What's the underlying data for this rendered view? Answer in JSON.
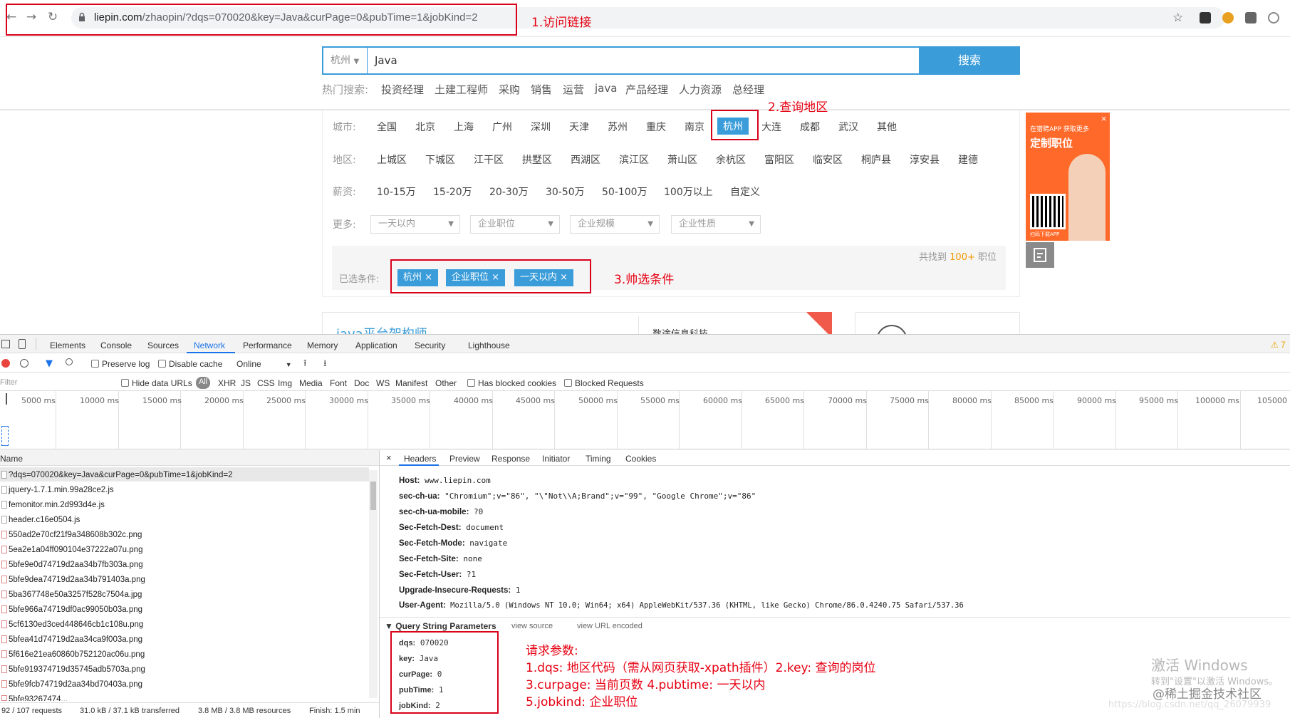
{
  "browser": {
    "url_host": "liepin.com",
    "url_path": "/zhaopin/?dqs=070020&key=Java&curPage=0&pubTime=1&jobKind=2"
  },
  "annotations": {
    "a1": "1.访问链接",
    "a2": "2.查询地区",
    "a3": "3.帅选条件"
  },
  "search": {
    "city": "杭州",
    "keyword": "Java",
    "button": "搜索",
    "hot_label": "热门搜索:",
    "hot_items": [
      "投资经理",
      "土建工程师",
      "采购",
      "销售",
      "运营",
      "java",
      "产品经理",
      "人力资源",
      "总经理"
    ]
  },
  "filters": {
    "city_label": "城市:",
    "cities": [
      "全国",
      "北京",
      "上海",
      "广州",
      "深圳",
      "天津",
      "苏州",
      "重庆",
      "南京",
      "杭州",
      "大连",
      "成都",
      "武汉",
      "其他"
    ],
    "district_label": "地区:",
    "districts": [
      "上城区",
      "下城区",
      "江干区",
      "拱墅区",
      "西湖区",
      "滨江区",
      "萧山区",
      "余杭区",
      "富阳区",
      "临安区",
      "桐庐县",
      "淳安县",
      "建德"
    ],
    "salary_label": "薪资:",
    "salaries": [
      "10-15万",
      "15-20万",
      "20-30万",
      "30-50万",
      "50-100万",
      "100万以上",
      "自定义"
    ],
    "more_label": "更多:",
    "dropdowns": [
      "一天以内",
      "企业职位",
      "企业规模",
      "企业性质"
    ],
    "found_prefix": "共找到",
    "found_count": "100+",
    "found_suffix": "职位",
    "selected_label": "已选条件:",
    "selected": [
      "杭州 ×",
      "企业职位 ×",
      "一天以内 ×"
    ]
  },
  "job_card": {
    "title": "java平台架构师",
    "company": "数途信息科技"
  },
  "ad": {
    "line1": "在猎聘APP 获取更多",
    "line2": "定制职位",
    "line3": "扫码下载APP"
  },
  "devtools": {
    "tabs": [
      "Elements",
      "Console",
      "Sources",
      "Network",
      "Performance",
      "Memory",
      "Application",
      "Security",
      "Lighthouse"
    ],
    "warning_count": "7",
    "preserve_log": "Preserve log",
    "disable_cache": "Disable cache",
    "throttle": "Online",
    "filter_placeholder": "Filter",
    "hide_data_urls": "Hide data URLs",
    "type_filters": [
      "All",
      "XHR",
      "JS",
      "CSS",
      "Img",
      "Media",
      "Font",
      "Doc",
      "WS",
      "Manifest",
      "Other"
    ],
    "has_blocked": "Has blocked cookies",
    "blocked_requests": "Blocked Requests",
    "ticks": [
      "5000 ms",
      "10000 ms",
      "15000 ms",
      "20000 ms",
      "25000 ms",
      "30000 ms",
      "35000 ms",
      "40000 ms",
      "45000 ms",
      "50000 ms",
      "55000 ms",
      "60000 ms",
      "65000 ms",
      "70000 ms",
      "75000 ms",
      "80000 ms",
      "85000 ms",
      "90000 ms",
      "95000 ms",
      "100000 ms",
      "105000"
    ],
    "name_header": "Name",
    "requests": [
      "?dqs=070020&key=Java&curPage=0&pubTime=1&jobKind=2",
      "jquery-1.7.1.min.99a28ce2.js",
      "femonitor.min.2d993d4e.js",
      "header.c16e0504.js",
      "550ad2e70cf21f9a348608b302c.png",
      "5ea2e1a04ff090104e37222a07u.png",
      "5bfe9e0d74719d2aa34b7fb303a.png",
      "5bfe9dea74719d2aa34b791403a.png",
      "5ba367748e50a3257f528c7504a.jpg",
      "5bfe966a74719df0ac99050b03a.png",
      "5cf6130ed3ced448646cb1c108u.png",
      "5bfea41d74719d2aa34ca9f003a.png",
      "5f616e21ea60860b752120ac06u.png",
      "5bfe919374719d35745adb5703a.png",
      "5bfe9fcb74719d2aa34bd70403a.png",
      "5bfe93267474..."
    ],
    "status": {
      "requests": "92 / 107 requests",
      "transferred": "31.0 kB / 37.1 kB transferred",
      "resources": "3.8 MB / 3.8 MB resources",
      "finish": "Finish: 1.5 min"
    },
    "detail_tabs": [
      "Headers",
      "Preview",
      "Response",
      "Initiator",
      "Timing",
      "Cookies"
    ],
    "headers": [
      {
        "k": "Host:",
        "v": "www.liepin.com"
      },
      {
        "k": "sec-ch-ua:",
        "v": "\"Chromium\";v=\"86\", \"\\\"Not\\\\A;Brand\";v=\"99\", \"Google Chrome\";v=\"86\""
      },
      {
        "k": "sec-ch-ua-mobile:",
        "v": "?0"
      },
      {
        "k": "Sec-Fetch-Dest:",
        "v": "document"
      },
      {
        "k": "Sec-Fetch-Mode:",
        "v": "navigate"
      },
      {
        "k": "Sec-Fetch-Site:",
        "v": "none"
      },
      {
        "k": "Sec-Fetch-User:",
        "v": "?1"
      },
      {
        "k": "Upgrade-Insecure-Requests:",
        "v": "1"
      },
      {
        "k": "User-Agent:",
        "v": "Mozilla/5.0 (Windows NT 10.0; Win64; x64) AppleWebKit/537.36 (KHTML, like Gecko) Chrome/86.0.4240.75 Safari/537.36"
      }
    ],
    "qsp_title": "Query String Parameters",
    "view_source": "view source",
    "view_url_encoded": "view URL encoded",
    "params": [
      {
        "k": "dqs:",
        "v": "070020"
      },
      {
        "k": "key:",
        "v": "Java"
      },
      {
        "k": "curPage:",
        "v": "0"
      },
      {
        "k": "pubTime:",
        "v": "1"
      },
      {
        "k": "jobKind:",
        "v": "2"
      }
    ]
  },
  "notes": [
    "请求参数:",
    "1.dqs: 地区代码（需从网页获取-xpath插件）2.key: 查询的岗位",
    "3.curpage: 当前页数 4.pubtime: 一天以内",
    "5.jobkind: 企业职位"
  ],
  "watermarks": {
    "activate1": "激活 Windows",
    "activate2": "转到\"设置\"以激活 Windows。",
    "site": "@稀土掘金技术社区",
    "csdn": "https://blog.csdn.net/qq_26079939"
  }
}
